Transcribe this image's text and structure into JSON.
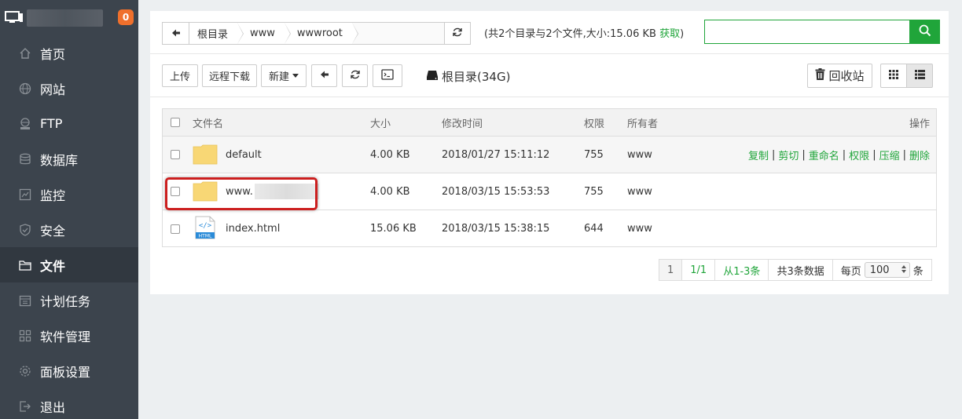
{
  "sidebar": {
    "badge": "0",
    "items": [
      {
        "label": "首页",
        "icon": "home-icon"
      },
      {
        "label": "网站",
        "icon": "globe-icon"
      },
      {
        "label": "FTP",
        "icon": "ftp-icon"
      },
      {
        "label": "数据库",
        "icon": "database-icon"
      },
      {
        "label": "监控",
        "icon": "monitor-chart-icon"
      },
      {
        "label": "安全",
        "icon": "shield-icon"
      },
      {
        "label": "文件",
        "icon": "folder-icon",
        "active": true
      },
      {
        "label": "计划任务",
        "icon": "calendar-icon"
      },
      {
        "label": "软件管理",
        "icon": "apps-icon"
      },
      {
        "label": "面板设置",
        "icon": "gear-icon"
      },
      {
        "label": "退出",
        "icon": "logout-icon"
      }
    ]
  },
  "path": {
    "crumbs": [
      "根目录",
      "www",
      "wwwroot"
    ],
    "summary_prefix": "(共2个目录与2个文件,大小:15.06 KB ",
    "fetch_label": "获取",
    "summary_suffix": ")"
  },
  "search": {
    "value": "",
    "placeholder": ""
  },
  "toolbar": {
    "upload": "上传",
    "remote_download": "远程下载",
    "new": "新建",
    "disk": "根目录(34G)",
    "recycle": "回收站"
  },
  "table": {
    "headers": {
      "name": "文件名",
      "size": "大小",
      "mtime": "修改时间",
      "perm": "权限",
      "owner": "所有者",
      "ops": "操作"
    },
    "rows": [
      {
        "name": "default",
        "size": "4.00 KB",
        "mtime": "2018/01/27 15:11:12",
        "perm": "755",
        "owner": "www",
        "type": "folder"
      },
      {
        "name": "www.",
        "size": "4.00 KB",
        "mtime": "2018/03/15 15:53:53",
        "perm": "755",
        "owner": "www",
        "type": "folder"
      },
      {
        "name": "index.html",
        "size": "15.06 KB",
        "mtime": "2018/03/15 15:38:15",
        "perm": "644",
        "owner": "www",
        "type": "html"
      }
    ],
    "ops": [
      "复制",
      "剪切",
      "重命名",
      "权限",
      "压缩",
      "删除"
    ]
  },
  "pager": {
    "current": "1",
    "pages": "1/1",
    "range": "从1-3条",
    "total": "共3条数据",
    "per_page_label": "每页",
    "per_page_value": "100",
    "unit": "条"
  },
  "colors": {
    "accent": "#20a53a",
    "sidebar": "#3c444d",
    "badge": "#f0702c",
    "highlight": "#cc1f1f"
  }
}
